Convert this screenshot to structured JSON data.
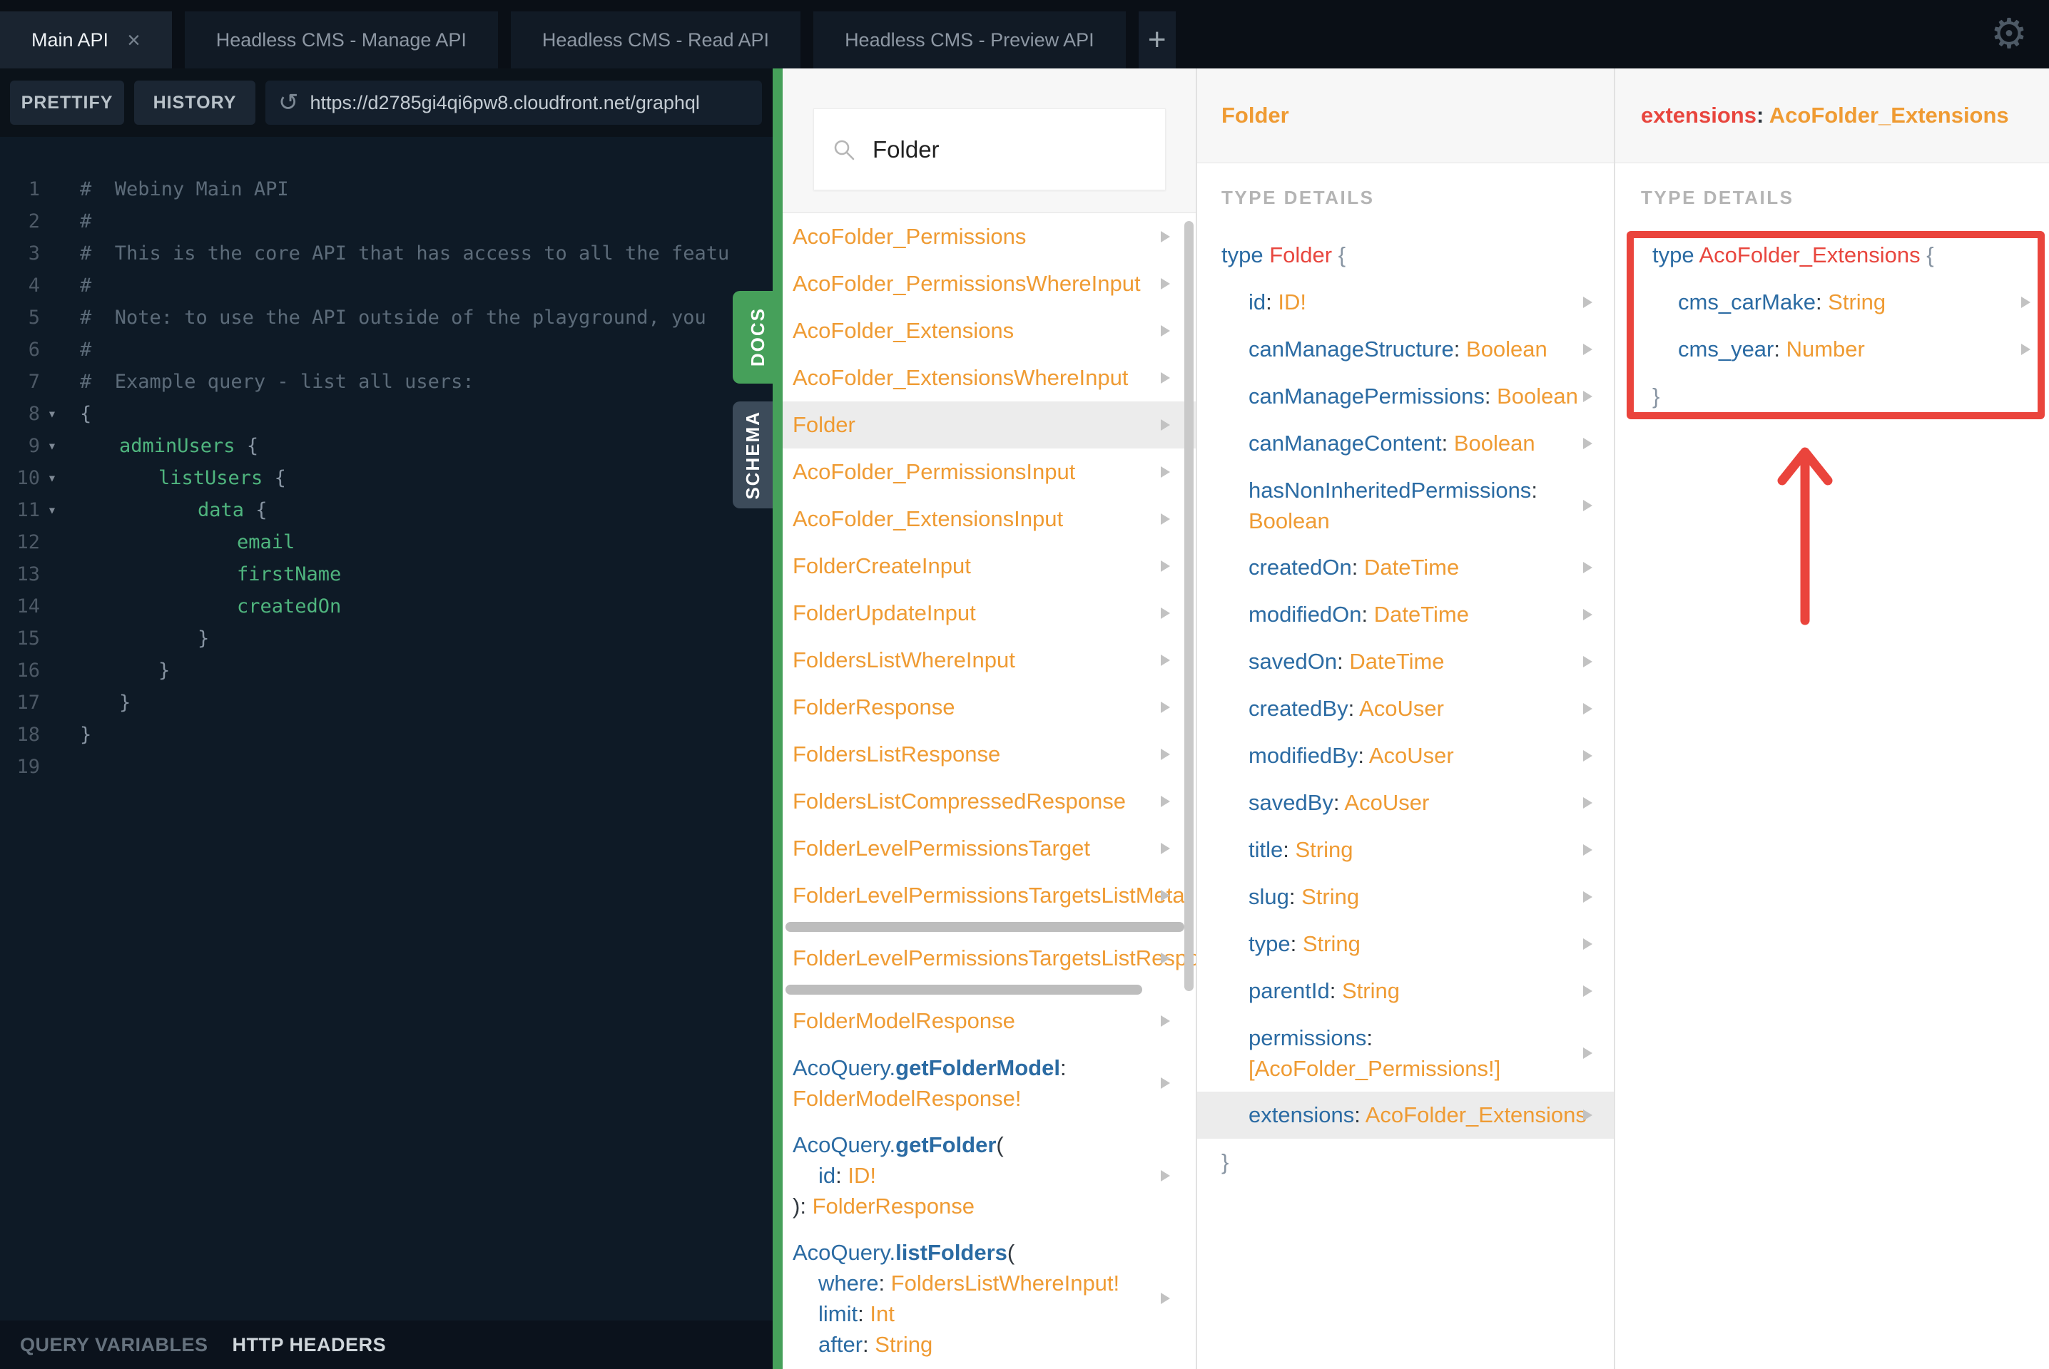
{
  "colors": {
    "accent_green": "#46a05a",
    "type_orange": "#ef9b33",
    "field_blue": "#2b6ba3",
    "type_red": "#e8463e",
    "annotation_red": "#ea443c"
  },
  "tabs": {
    "items": [
      {
        "label": "Main API",
        "active": true,
        "close": "×"
      },
      {
        "label": "Headless CMS - Manage API",
        "active": false
      },
      {
        "label": "Headless CMS - Read API",
        "active": false
      },
      {
        "label": "Headless CMS - Preview API",
        "active": false
      }
    ],
    "add_label": "+"
  },
  "toolbar": {
    "prettify": "PRETTIFY",
    "history": "HISTORY",
    "reload_icon": "↺",
    "url": "https://d2785gi4qi6pw8.cloudfront.net/graphql"
  },
  "side_tabs": {
    "docs": "DOCS",
    "schema": "SCHEMA"
  },
  "bottom_bar": {
    "query_variables": "QUERY VARIABLES",
    "http_headers": "HTTP HEADERS"
  },
  "editor": {
    "lines": [
      {
        "n": "1",
        "ind": 0,
        "segs": [
          [
            "#  Webiny Main API",
            "c"
          ]
        ]
      },
      {
        "n": "2",
        "ind": 0,
        "segs": [
          [
            "#",
            "c"
          ]
        ]
      },
      {
        "n": "3",
        "ind": 0,
        "segs": [
          [
            "#  This is the core API that has access to all the featu",
            "c"
          ]
        ]
      },
      {
        "n": "4",
        "ind": 0,
        "segs": [
          [
            "#",
            "c"
          ]
        ]
      },
      {
        "n": "5",
        "ind": 0,
        "segs": [
          [
            "#  Note: to use the API outside of the playground, you",
            "c"
          ]
        ]
      },
      {
        "n": "6",
        "ind": 0,
        "segs": [
          [
            "#",
            "c"
          ]
        ]
      },
      {
        "n": "7",
        "ind": 0,
        "segs": [
          [
            "#  Example query - list all users:",
            "c"
          ]
        ]
      },
      {
        "n": "8",
        "fold": true,
        "ind": 0,
        "segs": [
          [
            "{",
            "p"
          ]
        ]
      },
      {
        "n": "9",
        "fold": true,
        "ind": 1,
        "segs": [
          [
            "adminUsers ",
            "g"
          ],
          [
            "{",
            "p"
          ]
        ]
      },
      {
        "n": "10",
        "fold": true,
        "ind": 2,
        "segs": [
          [
            "listUsers ",
            "g"
          ],
          [
            "{",
            "p"
          ]
        ]
      },
      {
        "n": "11",
        "fold": true,
        "ind": 3,
        "segs": [
          [
            "data ",
            "g"
          ],
          [
            "{",
            "p"
          ]
        ]
      },
      {
        "n": "12",
        "ind": 4,
        "segs": [
          [
            "email",
            "g"
          ]
        ]
      },
      {
        "n": "13",
        "ind": 4,
        "segs": [
          [
            "firstName",
            "g"
          ]
        ]
      },
      {
        "n": "14",
        "ind": 4,
        "segs": [
          [
            "createdOn",
            "g"
          ]
        ]
      },
      {
        "n": "15",
        "ind": 3,
        "segs": [
          [
            "}",
            "p"
          ]
        ]
      },
      {
        "n": "16",
        "ind": 2,
        "segs": [
          [
            "}",
            "p"
          ]
        ]
      },
      {
        "n": "17",
        "ind": 1,
        "segs": [
          [
            "}",
            "p"
          ]
        ]
      },
      {
        "n": "18",
        "ind": 0,
        "segs": [
          [
            "}",
            "p"
          ]
        ]
      },
      {
        "n": "19",
        "ind": 0,
        "segs": []
      }
    ]
  },
  "docs": {
    "search_value": "Folder",
    "items": [
      {
        "lines": [
          {
            "i": 0,
            "s": [
              [
                "AcoFolder_Permissions",
                "o"
              ]
            ]
          }
        ]
      },
      {
        "lines": [
          {
            "i": 0,
            "s": [
              [
                "AcoFolder_PermissionsWhereInput",
                "o"
              ]
            ]
          }
        ]
      },
      {
        "lines": [
          {
            "i": 0,
            "s": [
              [
                "AcoFolder_Extensions",
                "o"
              ]
            ]
          }
        ]
      },
      {
        "lines": [
          {
            "i": 0,
            "s": [
              [
                "AcoFolder_ExtensionsWhereInput",
                "o"
              ]
            ]
          }
        ]
      },
      {
        "selected": true,
        "lines": [
          {
            "i": 0,
            "s": [
              [
                "Folder",
                "o"
              ]
            ]
          }
        ]
      },
      {
        "lines": [
          {
            "i": 0,
            "s": [
              [
                "AcoFolder_PermissionsInput",
                "o"
              ]
            ]
          }
        ]
      },
      {
        "lines": [
          {
            "i": 0,
            "s": [
              [
                "AcoFolder_ExtensionsInput",
                "o"
              ]
            ]
          }
        ]
      },
      {
        "lines": [
          {
            "i": 0,
            "s": [
              [
                "FolderCreateInput",
                "o"
              ]
            ]
          }
        ]
      },
      {
        "lines": [
          {
            "i": 0,
            "s": [
              [
                "FolderUpdateInput",
                "o"
              ]
            ]
          }
        ]
      },
      {
        "lines": [
          {
            "i": 0,
            "s": [
              [
                "FoldersListWhereInput",
                "o"
              ]
            ]
          }
        ]
      },
      {
        "lines": [
          {
            "i": 0,
            "s": [
              [
                "FolderResponse",
                "o"
              ]
            ]
          }
        ]
      },
      {
        "lines": [
          {
            "i": 0,
            "s": [
              [
                "FoldersListResponse",
                "o"
              ]
            ]
          }
        ]
      },
      {
        "lines": [
          {
            "i": 0,
            "s": [
              [
                "FoldersListCompressedResponse",
                "o"
              ]
            ]
          }
        ]
      },
      {
        "lines": [
          {
            "i": 0,
            "s": [
              [
                "FolderLevelPermissionsTarget",
                "o"
              ]
            ]
          }
        ]
      },
      {
        "hbar": 559,
        "lines": [
          {
            "i": 0,
            "s": [
              [
                "FolderLevelPermissionsTargetsListMeta",
                "o"
              ]
            ]
          }
        ]
      },
      {
        "hbar": 500,
        "lines": [
          {
            "i": 0,
            "s": [
              [
                "FolderLevelPermissionsTargetsListRespo",
                "o"
              ]
            ]
          }
        ]
      },
      {
        "lines": [
          {
            "i": 0,
            "s": [
              [
                "FolderModelResponse",
                "o"
              ]
            ]
          }
        ]
      },
      {
        "lines": [
          {
            "i": 0,
            "s": [
              [
                "AcoQuery.",
                "b"
              ],
              [
                "getFolderModel",
                "bb"
              ],
              [
                ":",
                "d"
              ]
            ]
          },
          {
            "i": 0,
            "s": [
              [
                "FolderModelResponse!",
                "o"
              ]
            ]
          }
        ]
      },
      {
        "lines": [
          {
            "i": 0,
            "s": [
              [
                "AcoQuery.",
                "b"
              ],
              [
                "getFolder",
                "bb"
              ],
              [
                "(",
                "d"
              ]
            ]
          },
          {
            "i": 1,
            "s": [
              [
                "id",
                "b"
              ],
              [
                ": ",
                "d"
              ],
              [
                "ID!",
                "o"
              ]
            ]
          },
          {
            "i": 0,
            "s": [
              [
                "): ",
                "d"
              ],
              [
                "FolderResponse",
                "o"
              ]
            ]
          }
        ]
      },
      {
        "lines": [
          {
            "i": 0,
            "s": [
              [
                "AcoQuery.",
                "b"
              ],
              [
                "listFolders",
                "bb"
              ],
              [
                "(",
                "d"
              ]
            ]
          },
          {
            "i": 1,
            "s": [
              [
                "where",
                "b"
              ],
              [
                ": ",
                "d"
              ],
              [
                "FoldersListWhereInput!",
                "o"
              ]
            ]
          },
          {
            "i": 1,
            "s": [
              [
                "limit",
                "b"
              ],
              [
                ": ",
                "d"
              ],
              [
                "Int",
                "o"
              ]
            ]
          },
          {
            "i": 1,
            "s": [
              [
                "after",
                "b"
              ],
              [
                ": ",
                "d"
              ],
              [
                "String",
                "o"
              ]
            ]
          }
        ]
      }
    ]
  },
  "type_panel": {
    "title": "Folder",
    "section": "TYPE DETAILS",
    "decl": [
      [
        "type ",
        "k"
      ],
      [
        "Folder ",
        "r"
      ],
      [
        "{",
        "p"
      ]
    ],
    "fields": [
      {
        "name": "id",
        "type": "ID!"
      },
      {
        "name": "canManageStructure",
        "type": "Boolean"
      },
      {
        "name": "canManagePermissions",
        "type": "Boolean"
      },
      {
        "name": "canManageContent",
        "type": "Boolean"
      },
      {
        "name": "hasNonInheritedPermissions",
        "type": "Boolean",
        "wrap": true
      },
      {
        "name": "createdOn",
        "type": "DateTime"
      },
      {
        "name": "modifiedOn",
        "type": "DateTime"
      },
      {
        "name": "savedOn",
        "type": "DateTime"
      },
      {
        "name": "createdBy",
        "type": "AcoUser"
      },
      {
        "name": "modifiedBy",
        "type": "AcoUser"
      },
      {
        "name": "savedBy",
        "type": "AcoUser"
      },
      {
        "name": "title",
        "type": "String"
      },
      {
        "name": "slug",
        "type": "String"
      },
      {
        "name": "type",
        "type": "String"
      },
      {
        "name": "parentId",
        "type": "String"
      },
      {
        "name": "permissions",
        "type": "[AcoFolder_Permissions!]",
        "wrap": true
      },
      {
        "name": "extensions",
        "type": "AcoFolder_Extensions",
        "selected": true
      }
    ],
    "close": "}"
  },
  "extensions_panel": {
    "title": [
      [
        "extensions",
        "r"
      ],
      [
        ": ",
        "d"
      ],
      [
        "AcoFolder_Extensions",
        "o"
      ]
    ],
    "section": "TYPE DETAILS",
    "decl": [
      [
        "type ",
        "k"
      ],
      [
        "AcoFolder_Extensions ",
        "r"
      ],
      [
        "{",
        "p"
      ]
    ],
    "fields": [
      {
        "name": "cms_carMake",
        "type": "String"
      },
      {
        "name": "cms_year",
        "type": "Number"
      }
    ],
    "close": "}"
  }
}
